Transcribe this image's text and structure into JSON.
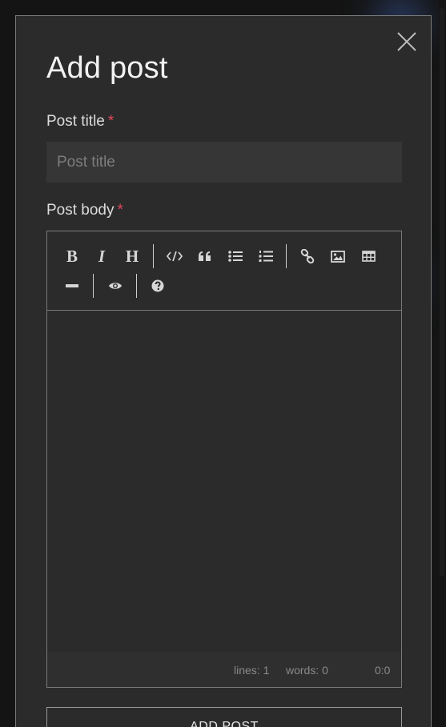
{
  "modal": {
    "title": "Add post",
    "close_label": "close"
  },
  "form": {
    "post_title_label": "Post title",
    "post_title_required": "*",
    "post_title_placeholder": "Post title",
    "post_title_value": "",
    "post_body_label": "Post body",
    "post_body_required": "*",
    "submit_label": "ADD POST"
  },
  "toolbar": {
    "bold_glyph": "B",
    "italic_glyph": "I",
    "heading_glyph": "H",
    "buttons": [
      "bold",
      "italic",
      "heading",
      "code",
      "quote",
      "unordered-list",
      "ordered-list",
      "link",
      "image",
      "table",
      "horizontal-rule",
      "preview",
      "guide"
    ]
  },
  "statusbar": {
    "lines": "lines: 1",
    "words": "words: 0",
    "cursor": "0:0"
  },
  "colors": {
    "modal_bg": "#2b2b2c",
    "required_star": "#e0475a",
    "border": "#7a7a7a",
    "input_bg": "#363637"
  }
}
